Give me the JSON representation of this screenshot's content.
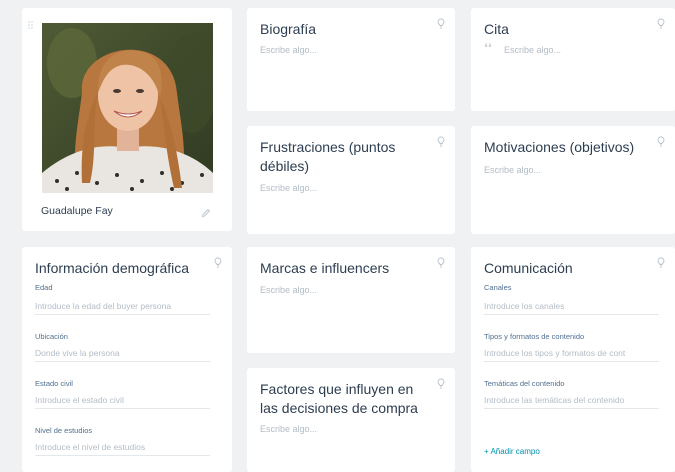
{
  "profile": {
    "name": "Guadalupe Fay",
    "photo_icon": "portrait-photo",
    "edit_icon": "pencil-icon",
    "drag_icon": "drag-handle-icon"
  },
  "cards": {
    "biografia": {
      "title": "Biografía",
      "placeholder": "Escribe algo..."
    },
    "cita": {
      "title": "Cita",
      "quote_mark": "❛❛",
      "placeholder": "Escribe algo..."
    },
    "frustraciones": {
      "title": "Frustraciones (puntos débiles)",
      "placeholder": "Escribe algo..."
    },
    "motivaciones": {
      "title": "Motivaciones (objetivos)",
      "placeholder": "Escribe algo..."
    },
    "marcas": {
      "title": "Marcas e influencers",
      "placeholder": "Escribe algo..."
    },
    "factores": {
      "title": "Factores que influyen en las decisiones de compra",
      "placeholder": "Escribe algo..."
    }
  },
  "demografica": {
    "title": "Información demográfica",
    "fields": [
      {
        "label": "Edad",
        "placeholder": "Introduce la edad del buyer persona"
      },
      {
        "label": "Ubicación",
        "placeholder": "Donde vive la persona"
      },
      {
        "label": "Estado civil",
        "placeholder": "Introduce el estado civil"
      },
      {
        "label": "Nivel de estudios",
        "placeholder": "Introduce el nivel de estudios"
      }
    ]
  },
  "comunicacion": {
    "title": "Comunicación",
    "fields": [
      {
        "label": "Canales",
        "placeholder": "Introduce los canales"
      },
      {
        "label": "Tipos y formatos de contenido",
        "placeholder": "Introduce los tipos y formatos de cont"
      },
      {
        "label": "Temáticas del contenido",
        "placeholder": "Introduce las temáticas del contenido"
      }
    ],
    "add_field": "+ Añadir campo"
  },
  "colors": {
    "background": "#f0f1f3",
    "card": "#ffffff",
    "title": "#2d3e50",
    "placeholder": "#b3bcc6",
    "link": "#0091ae",
    "pin": "#b7c1cc"
  }
}
